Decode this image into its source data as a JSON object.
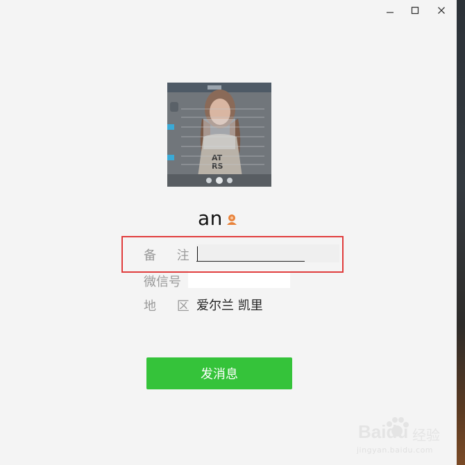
{
  "window_controls": {
    "minimize_icon": "minimize-icon",
    "maximize_icon": "maximize-icon",
    "close_icon": "close-icon"
  },
  "profile": {
    "name": "an",
    "gender_icon": "female-icon",
    "gender_color": "#e8823a"
  },
  "fields": {
    "remark_label": "备 注",
    "remark_value": "",
    "wechat_label": "微信号",
    "wechat_value": "",
    "region_label": "地 区",
    "region_value": "爱尔兰 凯里"
  },
  "actions": {
    "send_message_label": "发消息"
  },
  "colors": {
    "accent_green": "#35c33a",
    "highlight_red": "#e03b3b"
  },
  "watermark": {
    "brand": "Baidu",
    "brand_cn": "经验",
    "url": "jingyan.baidu.com"
  }
}
